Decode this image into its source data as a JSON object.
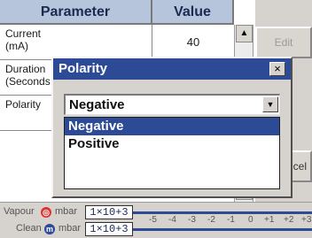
{
  "table": {
    "header_parameter": "Parameter",
    "header_value": "Value",
    "rows": [
      {
        "name": "Current\n(mA)",
        "value": "40"
      },
      {
        "name": "Duration\n(Seconds",
        "value": ""
      },
      {
        "name": "Polarity",
        "value": ""
      }
    ]
  },
  "side_buttons": {
    "edit_label": "Edit",
    "cancel_label": "cel"
  },
  "dialog": {
    "title": "Polarity",
    "close_glyph": "×",
    "selected_value": "Negative",
    "options": [
      "Negative",
      "Positive"
    ],
    "highlighted_index": 0
  },
  "gauges": [
    {
      "label": "Vapour",
      "unit": "mbar",
      "value": "1×10+3",
      "icon": "flame-icon",
      "icon_color": "#e03030"
    },
    {
      "label": "Clean",
      "unit": "mbar",
      "value": "1×10+3",
      "icon": "m-icon",
      "icon_color": "#2d4a96"
    }
  ],
  "scale_ticks": [
    "-5",
    "-4",
    "-3",
    "-2",
    "-1",
    "0",
    "+1",
    "+2",
    "+3"
  ]
}
